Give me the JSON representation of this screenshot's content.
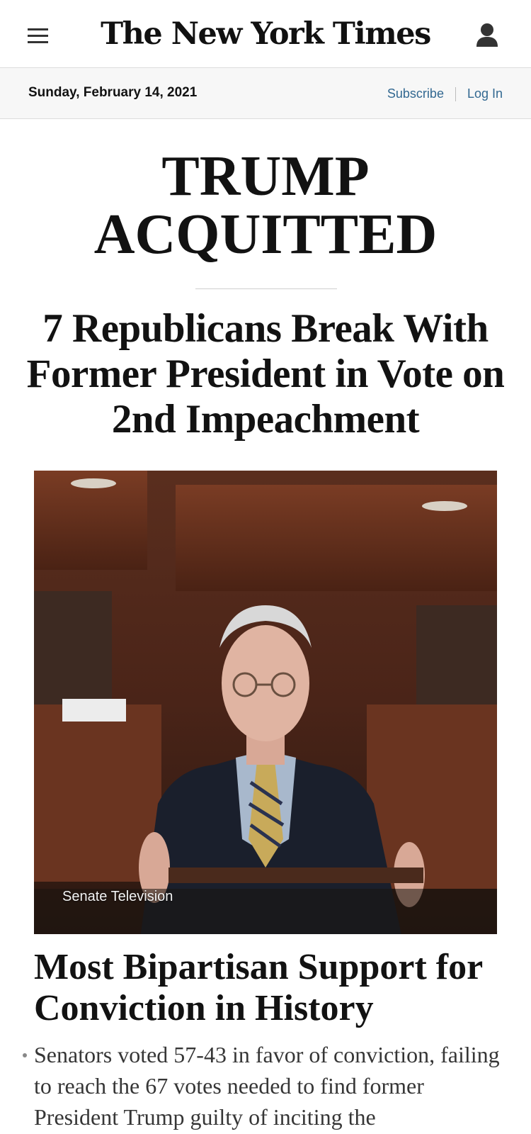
{
  "header": {
    "masthead": "The New York Times",
    "menu_icon": "hamburger-menu-icon",
    "user_icon": "user-account-icon"
  },
  "datebar": {
    "date": "Sunday, February 14, 2021",
    "subscribe": "Subscribe",
    "login": "Log In"
  },
  "lead": {
    "banner_line1": "TRUMP",
    "banner_line2": "ACQUITTED",
    "subhead": "7 Republicans Break With Former President in Vote on 2nd Impeachment",
    "photo_credit": "Senate Television"
  },
  "story": {
    "headline": "Most Bipartisan Support for Conviction in History",
    "summary": "Senators voted 57-43 in favor of conviction, failing to reach the 67 votes needed to find former President Trump guilty of inciting the"
  },
  "colors": {
    "link": "#326891",
    "text": "#121212",
    "datebar_bg": "#f7f7f7"
  }
}
